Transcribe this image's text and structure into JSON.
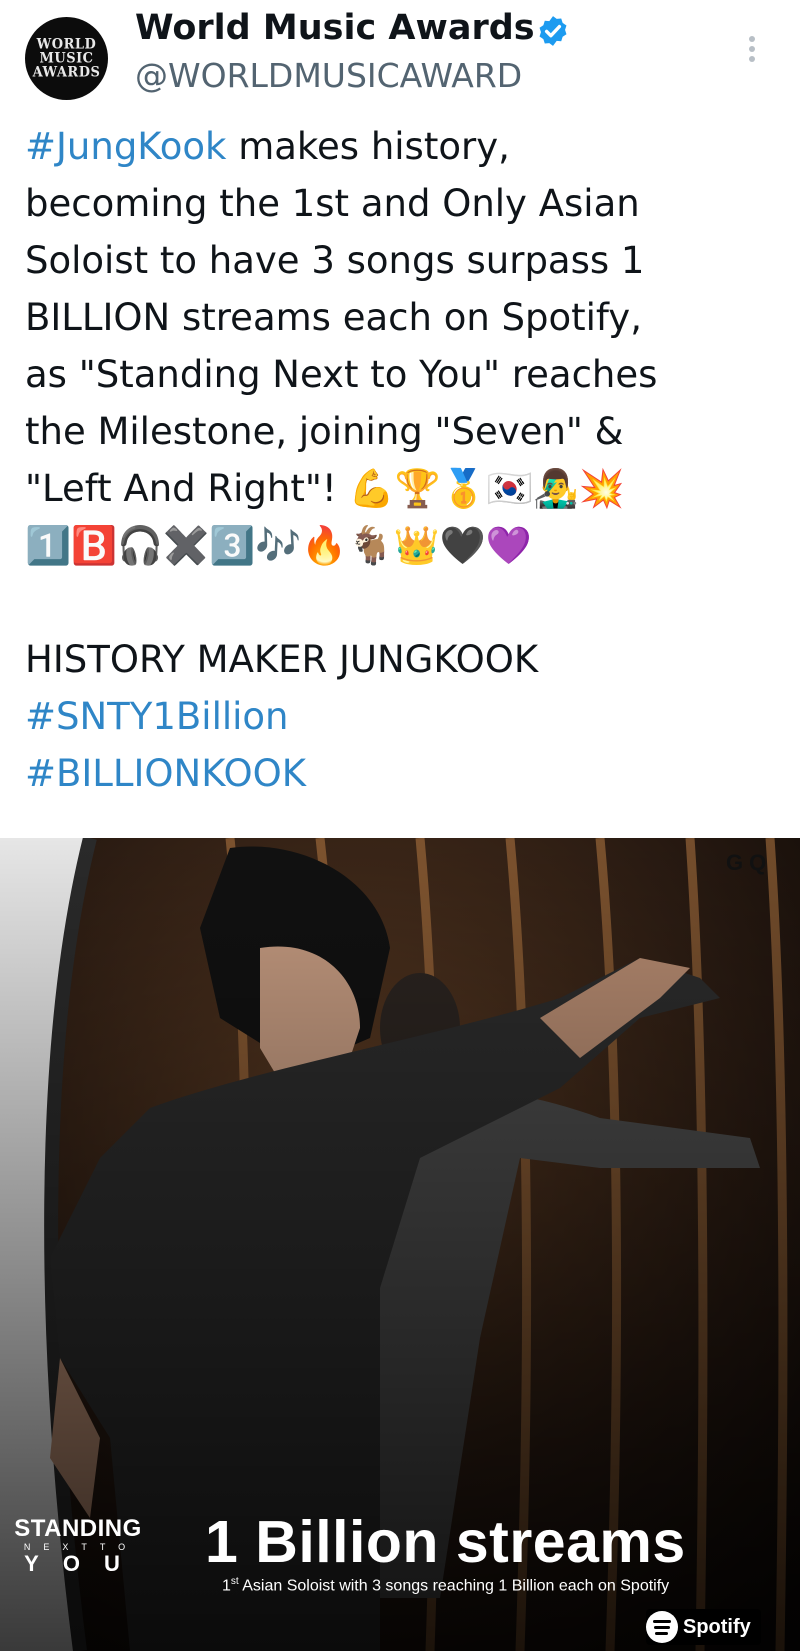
{
  "account": {
    "name": "World Music Awards",
    "handle": "@WORLDMUSICAWARD",
    "avatar_text": [
      "WORLD",
      "MUSIC",
      "AWARDS"
    ],
    "verified_icon": "verified-badge-icon",
    "more_icon": "more-vertical-icon"
  },
  "tweet": {
    "lines": [
      {
        "tag": "#JungKook",
        "text": " makes history,"
      },
      {
        "text": "becoming the 1st and Only Asian"
      },
      {
        "text": "Soloist to have 3 songs surpass 1"
      },
      {
        "text": "BILLION streams each on Spotify,"
      },
      {
        "text": "as \"Standing Next to You\" reaches"
      },
      {
        "text": "the Milestone, joining  \"Seven\" &"
      },
      {
        "text": "\"Left And Right\"!"
      }
    ],
    "emoji_line_1": "💪🏆🥇🇰🇷👨‍🎤💥",
    "emoji_line_2": "1️⃣🅱️🎧✖️3️⃣🎶🔥🐐👑🖤💜",
    "history_line": "HISTORY MAKER JUNGKOOK",
    "hashtags": [
      "#SNTY1Billion",
      "#BILLIONKOOK"
    ]
  },
  "media": {
    "corner_mark": "GQ",
    "logo": {
      "line1": "STANDING",
      "line2": "NEXTTO",
      "line3": "YOU"
    },
    "headline": "1 Billion streams",
    "subline_sup": "st",
    "subline_prefix": "1",
    "subline_rest": " Asian Soloist with 3 songs reaching 1 Billion each on Spotify",
    "badge": "Spotify",
    "colors": {
      "text_accent": "#2f86c7",
      "background": "#1a1410"
    }
  }
}
